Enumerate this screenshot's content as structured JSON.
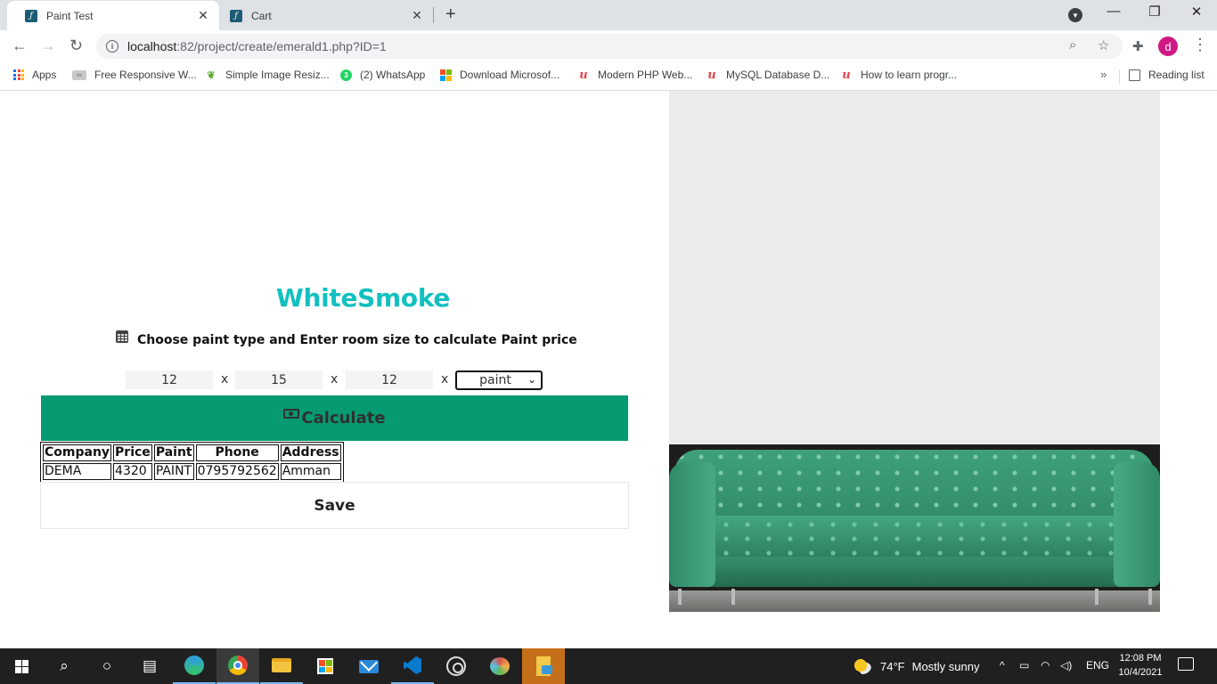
{
  "browser": {
    "tabs": [
      {
        "title": "Paint Test",
        "active": true
      },
      {
        "title": "Cart",
        "active": false
      }
    ],
    "new_tab_label": "+",
    "url_host": "localhost",
    "url_rest": ":82/project/create/emerald1.php?ID=1",
    "profile_initial": "d",
    "bookmarks": [
      {
        "label": "Apps",
        "icon": "apps-grid-icon"
      },
      {
        "label": "Free Responsive W...",
        "icon": "responsive-site-icon"
      },
      {
        "label": "Simple Image Resiz...",
        "icon": "leaf-icon"
      },
      {
        "label": "(2) WhatsApp",
        "icon": "whatsapp-icon",
        "badge": "3"
      },
      {
        "label": "Download Microsof...",
        "icon": "microsoft-icon"
      },
      {
        "label": "Modern PHP Web...",
        "icon": "udemy-icon"
      },
      {
        "label": "MySQL Database D...",
        "icon": "udemy-icon"
      },
      {
        "label": "How to learn progr...",
        "icon": "udemy-icon"
      }
    ],
    "more_bookmarks": "»",
    "reading_list": "Reading list"
  },
  "page": {
    "color_name": "WhiteSmoke",
    "color_name_color": "#12c0c0",
    "instruction": "Choose paint type and Enter room size to calculate Paint price",
    "dimensions": {
      "length": "12",
      "width": "15",
      "height": "12"
    },
    "times_sign": "x",
    "paint_select": {
      "selected": "paint"
    },
    "calculate_label": "Calculate",
    "calculate_color": "#059a72",
    "table": {
      "headers": [
        "Company",
        "Price",
        "Paint",
        "Phone",
        "Address"
      ],
      "rows": [
        [
          "DEMA",
          "4320",
          "PAINT",
          "0795792562",
          "Amman"
        ]
      ]
    },
    "save_label": "Save",
    "preview_wall_color": "#ebebeb",
    "preview_object": "green tufted sofa"
  },
  "taskbar": {
    "apps": [
      "start",
      "search",
      "cortana",
      "task-view",
      "edge",
      "chrome",
      "file-explorer",
      "store",
      "mail",
      "vscode",
      "obs",
      "paint",
      "xampp"
    ],
    "weather_temp": "74°F",
    "weather_text": "Mostly sunny",
    "language": "ENG",
    "time": "12:08 PM",
    "date": "10/4/2021"
  }
}
